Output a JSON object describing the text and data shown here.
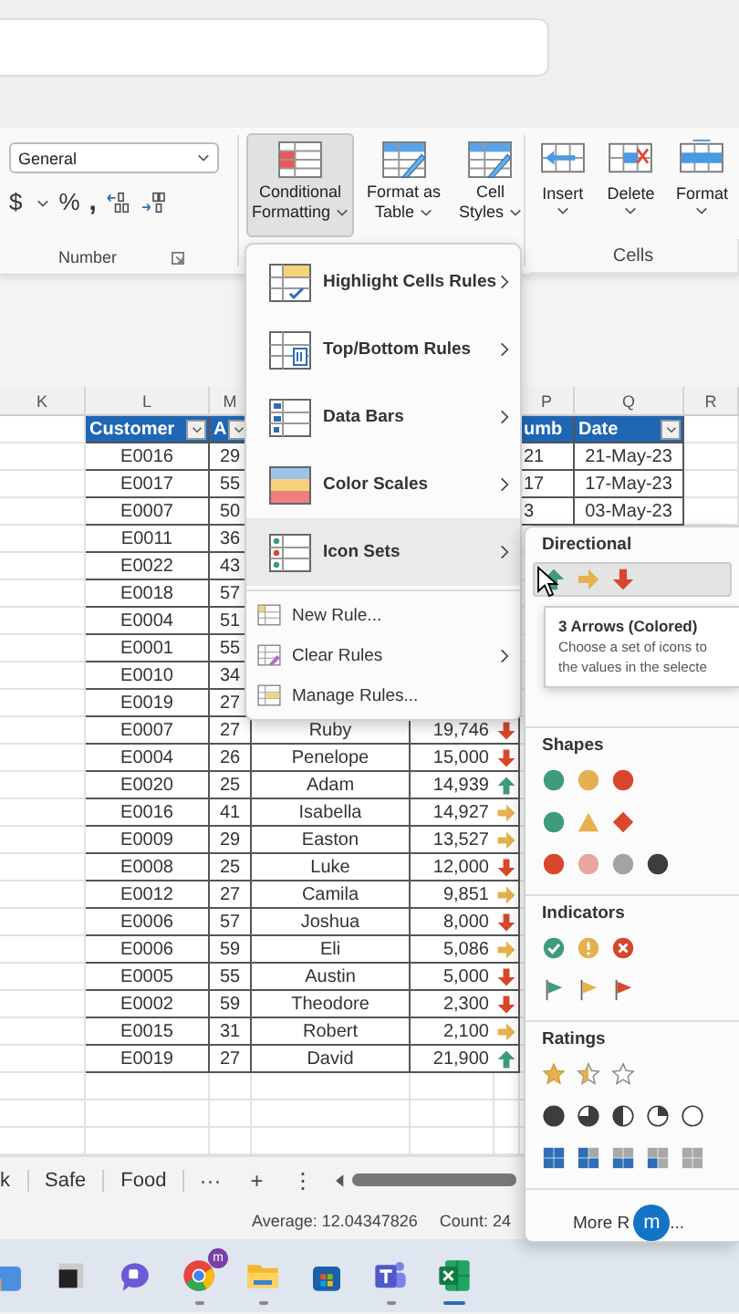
{
  "ribbon": {
    "number_format": "General",
    "number_buttons": [
      "$",
      "%",
      ","
    ],
    "number_group": "Number",
    "style_buttons": [
      {
        "lines": [
          "Conditional",
          "Formatting"
        ],
        "pressed": true
      },
      {
        "lines": [
          "Format as",
          "Table"
        ],
        "pressed": false
      },
      {
        "lines": [
          "Cell",
          "Styles"
        ],
        "pressed": false
      }
    ],
    "cell_buttons": [
      "Insert",
      "Delete",
      "Format"
    ],
    "cells_group": "Cells"
  },
  "column_letters": [
    "K",
    "L",
    "M",
    "P",
    "Q",
    "R"
  ],
  "table": {
    "columns": [
      {
        "label": "Customer",
        "filter": true
      },
      {
        "label": "A",
        "filter": true
      },
      {
        "label": "umb",
        "filter": false
      },
      {
        "label": "Date",
        "filter": true
      }
    ],
    "rows": [
      {
        "customer": "E0016",
        "age": "29",
        "number": "21",
        "date": "21-May-23"
      },
      {
        "customer": "E0017",
        "age": "55",
        "number": "17",
        "date": "17-May-23"
      },
      {
        "customer": "E0007",
        "age": "50",
        "number": "3",
        "date": "03-May-23"
      },
      {
        "customer": "E0011",
        "age": "36"
      },
      {
        "customer": "E0022",
        "age": "43"
      },
      {
        "customer": "E0018",
        "age": "57"
      },
      {
        "customer": "E0004",
        "age": "51"
      },
      {
        "customer": "E0001",
        "age": "55"
      },
      {
        "customer": "E0010",
        "age": "34"
      },
      {
        "customer": "E0019",
        "age": "27"
      },
      {
        "customer": "E0007",
        "age": "27",
        "name": "Ruby",
        "amount": "19,746",
        "kind": "down"
      },
      {
        "customer": "E0004",
        "age": "26",
        "name": "Penelope",
        "amount": "15,000",
        "kind": "down"
      },
      {
        "customer": "E0020",
        "age": "25",
        "name": "Adam",
        "amount": "14,939",
        "kind": "up"
      },
      {
        "customer": "E0016",
        "age": "41",
        "name": "Isabella",
        "amount": "14,927",
        "kind": "right"
      },
      {
        "customer": "E0009",
        "age": "29",
        "name": "Easton",
        "amount": "13,527",
        "kind": "right"
      },
      {
        "customer": "E0008",
        "age": "25",
        "name": "Luke",
        "amount": "12,000",
        "kind": "down"
      },
      {
        "customer": "E0012",
        "age": "27",
        "name": "Camila",
        "amount": "9,851",
        "kind": "right"
      },
      {
        "customer": "E0006",
        "age": "57",
        "name": "Joshua",
        "amount": "8,000",
        "kind": "down"
      },
      {
        "customer": "E0006",
        "age": "59",
        "name": "Eli",
        "amount": "5,086",
        "kind": "right"
      },
      {
        "customer": "E0005",
        "age": "55",
        "name": "Austin",
        "amount": "5,000",
        "kind": "down"
      },
      {
        "customer": "E0002",
        "age": "59",
        "name": "Theodore",
        "amount": "2,300",
        "kind": "down"
      },
      {
        "customer": "E0015",
        "age": "31",
        "name": "Robert",
        "amount": "2,100",
        "kind": "right"
      },
      {
        "customer": "E0019",
        "age": "27",
        "name": "David",
        "amount": "21,900",
        "kind": "up"
      }
    ]
  },
  "cf_menu": {
    "items": [
      {
        "label": "Highlight Cells Rules",
        "kind": "large",
        "submenu": true,
        "selected": false
      },
      {
        "label": "Top/Bottom Rules",
        "kind": "large",
        "submenu": true,
        "selected": false
      },
      {
        "label": "Data Bars",
        "kind": "large",
        "submenu": true,
        "selected": false
      },
      {
        "label": "Color Scales",
        "kind": "large",
        "submenu": true,
        "selected": false
      },
      {
        "label": "Icon Sets",
        "kind": "large",
        "submenu": true,
        "selected": true
      },
      {
        "label": "New Rule...",
        "kind": "small",
        "submenu": false,
        "selected": false
      },
      {
        "label": "Clear Rules",
        "kind": "small",
        "submenu": true,
        "selected": false
      },
      {
        "label": "Manage Rules...",
        "kind": "small",
        "submenu": false,
        "selected": false
      }
    ]
  },
  "icon_sets": {
    "sections": [
      {
        "title": "Directional",
        "sets": [
          {
            "kind": "arrows",
            "selected": true
          }
        ]
      },
      {
        "title": "Shapes",
        "sets": [
          {
            "kind": "traffic-lights",
            "selected": false
          },
          {
            "kind": "signs",
            "selected": false
          },
          {
            "kind": "red-to-black",
            "selected": false
          }
        ]
      },
      {
        "title": "Indicators",
        "sets": [
          {
            "kind": "symbols",
            "selected": false
          },
          {
            "kind": "flags",
            "selected": false
          }
        ]
      },
      {
        "title": "Ratings",
        "sets": [
          {
            "kind": "stars",
            "selected": false
          },
          {
            "kind": "quarters",
            "selected": false
          },
          {
            "kind": "boxes",
            "selected": false
          }
        ]
      }
    ],
    "tooltip": {
      "title": "3 Arrows (Colored)",
      "lines": [
        "Choose a set of icons to",
        "the values in the selecte"
      ]
    },
    "more_rules": "More R",
    "more_rules_tail": "...",
    "badge": "m"
  },
  "sheet_tabs": [
    "k",
    "Safe",
    "Food"
  ],
  "tab_tools": [
    "···",
    "+",
    "⋮"
  ],
  "status_bar": {
    "average": "Average: 12.04347826",
    "count": "Count: 24"
  },
  "taskbar": [
    {
      "kind": "pinned"
    },
    {
      "kind": "pinned"
    },
    {
      "kind": "pinned"
    },
    {
      "kind": "running",
      "badge": "m"
    },
    {
      "kind": "running"
    },
    {
      "kind": "pinned"
    },
    {
      "kind": "running"
    },
    {
      "kind": "active"
    }
  ]
}
